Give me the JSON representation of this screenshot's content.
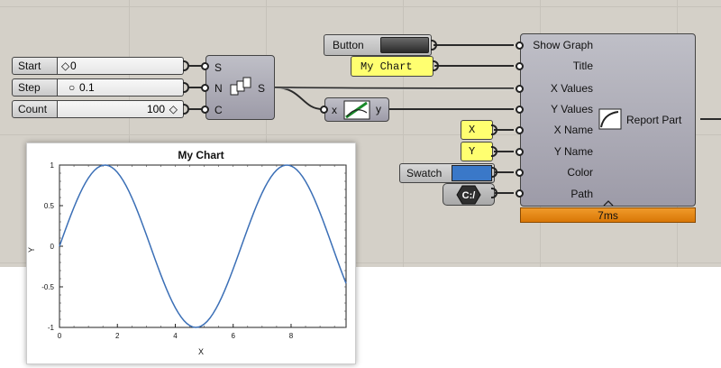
{
  "sliders": [
    {
      "label": "Start",
      "value": "0"
    },
    {
      "label": "Step",
      "value": "0.1"
    },
    {
      "label": "Count",
      "value": "100"
    }
  ],
  "series_node": {
    "inputs": [
      "S",
      "N",
      "C"
    ],
    "output": "S"
  },
  "expression_node": {
    "input": "x",
    "output": "y"
  },
  "button": {
    "label": "Button"
  },
  "title_panel": {
    "text": "My Chart"
  },
  "x_panel": {
    "text": "X"
  },
  "y_panel": {
    "text": "Y"
  },
  "swatch": {
    "label": "Swatch",
    "color": "#3a78c8"
  },
  "path_param": {
    "label": "C:/"
  },
  "report_part": {
    "name": "Report Part",
    "inputs": [
      "Show Graph",
      "Title",
      "X Values",
      "Y Values",
      "X Name",
      "Y Name",
      "Color",
      "Path"
    ],
    "runtime": "7ms"
  },
  "chart_data": {
    "type": "line",
    "title": "My Chart",
    "xlabel": "X",
    "ylabel": "Y",
    "xlim": [
      0,
      9.9
    ],
    "ylim": [
      -1,
      1
    ],
    "xticks": [
      "0",
      "2",
      "4",
      "6",
      "8"
    ],
    "yticks": [
      "1",
      "0.5",
      "0",
      "-0.5",
      "-1"
    ],
    "series": [
      {
        "function": "sin",
        "start": 0,
        "step": 0.1,
        "count": 100,
        "color": "#3b6fb6"
      }
    ]
  }
}
